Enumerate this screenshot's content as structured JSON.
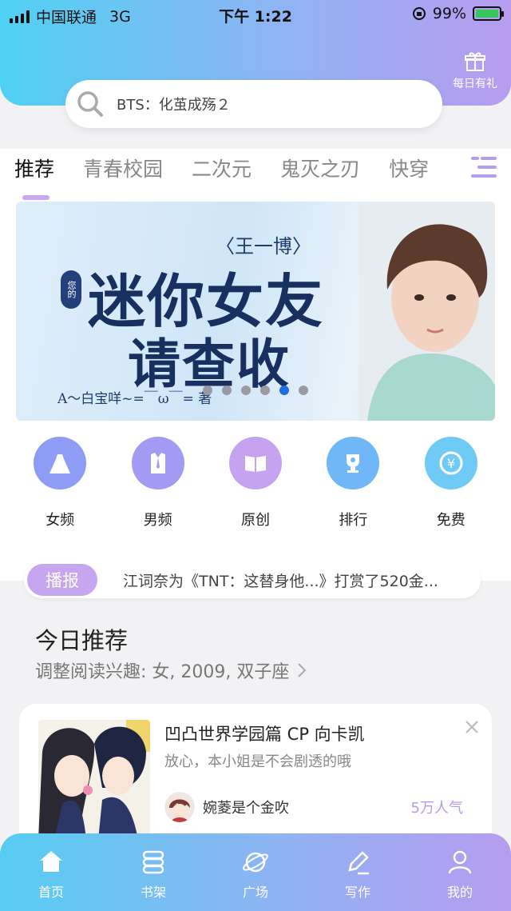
{
  "status_bar": {
    "carrier": "中国联通",
    "network": "3G",
    "time": "下午 1:22",
    "battery": "99%"
  },
  "header": {
    "gift_label": "每日有礼"
  },
  "search": {
    "placeholder": "BTS：化茧成殇２"
  },
  "tabs": [
    {
      "label": "推荐",
      "active": true
    },
    {
      "label": "青春校园"
    },
    {
      "label": "二次元"
    },
    {
      "label": "鬼灭之刃"
    },
    {
      "label": "快穿"
    }
  ],
  "banner": {
    "tag": "〈王一博〉",
    "badge": "您的",
    "title_line1": "迷你女友",
    "title_line2": "请查收",
    "author": "A～白宝咩~=￣ω￣= 著",
    "dot_count": 6,
    "active_dot": 4
  },
  "entries": [
    {
      "label": "女频",
      "icon": "dress-icon",
      "color": "#8f9cf5"
    },
    {
      "label": "男频",
      "icon": "shirt-icon",
      "color": "#a29af3"
    },
    {
      "label": "原创",
      "icon": "book-icon",
      "color": "#c5a3f0"
    },
    {
      "label": "排行",
      "icon": "trophy-icon",
      "color": "#6fb7f6"
    },
    {
      "label": "免费",
      "icon": "yuan-coin-icon",
      "color": "#6fcaf6"
    }
  ],
  "broadcast": {
    "label": "播报",
    "message": "江词奈为《TNT：这替身他...》打赏了520金..."
  },
  "recommend": {
    "title": "今日推荐",
    "subtitle": "调整阅读兴趣: 女, 2009, 双子座",
    "card": {
      "title": "凹凸世界学园篇 CP 向卡凯",
      "desc": "放心，本小姐是不会剧透的哦",
      "author": "婉菱是个金吹",
      "popularity": "5万人气"
    }
  },
  "bottom_nav": [
    {
      "label": "首页",
      "icon": "home-icon",
      "active": true
    },
    {
      "label": "书架",
      "icon": "bookshelf-icon"
    },
    {
      "label": "广场",
      "icon": "planet-icon"
    },
    {
      "label": "写作",
      "icon": "pen-icon"
    },
    {
      "label": "我的",
      "icon": "user-icon"
    }
  ]
}
